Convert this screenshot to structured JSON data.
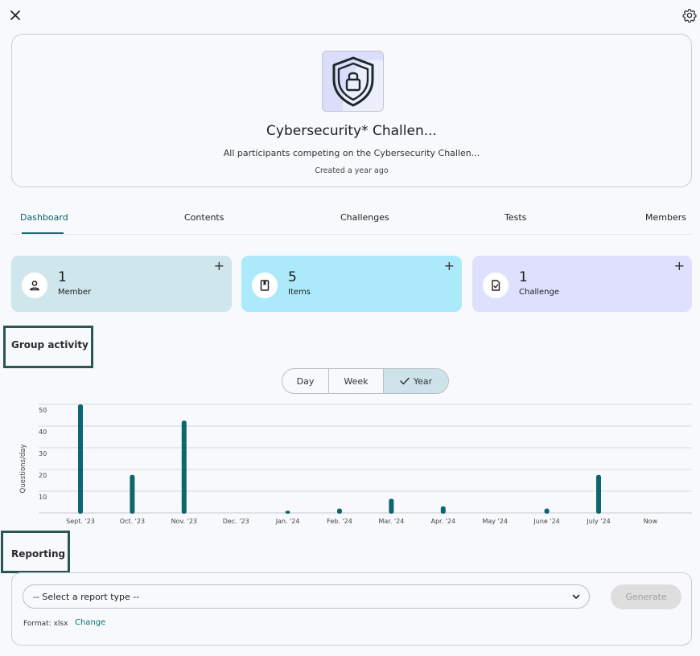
{
  "header": {
    "close_icon": "close-icon",
    "settings_icon": "gear-icon"
  },
  "group": {
    "logo_icon": "shield-lock-icon",
    "title": "Cybersecurity* Challen...",
    "description": "All participants competing on the Cybersecurity Challen...",
    "created": "Created a year ago"
  },
  "tabs": [
    {
      "label": "Dashboard",
      "active": true
    },
    {
      "label": "Contents",
      "active": false
    },
    {
      "label": "Challenges",
      "active": false
    },
    {
      "label": "Tests",
      "active": false
    },
    {
      "label": "Members",
      "active": false
    }
  ],
  "stats": [
    {
      "count": "1",
      "label": "Member",
      "icon": "person-icon",
      "color": "#cfe6ec"
    },
    {
      "count": "5",
      "label": "Items",
      "icon": "book-icon",
      "color": "#aceafb"
    },
    {
      "count": "1",
      "label": "Challenge",
      "icon": "checklist-icon",
      "color": "#dfe0fd"
    }
  ],
  "activity": {
    "title": "Group activity",
    "ranges": [
      "Day",
      "Week",
      "Year"
    ],
    "selected_range": "Year"
  },
  "chart_data": {
    "type": "bar",
    "ylabel": "Questions/day",
    "ylim": [
      0,
      50
    ],
    "yticks": [
      10,
      20,
      30,
      40,
      50
    ],
    "categories": [
      "Sept. '23",
      "Oct. '23",
      "Nov. '23",
      "Dec. '23",
      "Jan. '24",
      "Feb. '24",
      "Mar. '24",
      "Apr. '24",
      "May '24",
      "June '24",
      "July '24",
      "Now"
    ],
    "values": [
      50,
      17.5,
      42.5,
      0,
      1,
      2,
      6.5,
      3,
      0,
      2,
      17.5,
      0
    ],
    "bar_color": "#0d6570",
    "grid": true
  },
  "reporting": {
    "title": "Reporting",
    "select_placeholder": "-- Select a report type --",
    "generate_label": "Generate",
    "format_label": "Format: xlsx",
    "change_label": "Change"
  }
}
